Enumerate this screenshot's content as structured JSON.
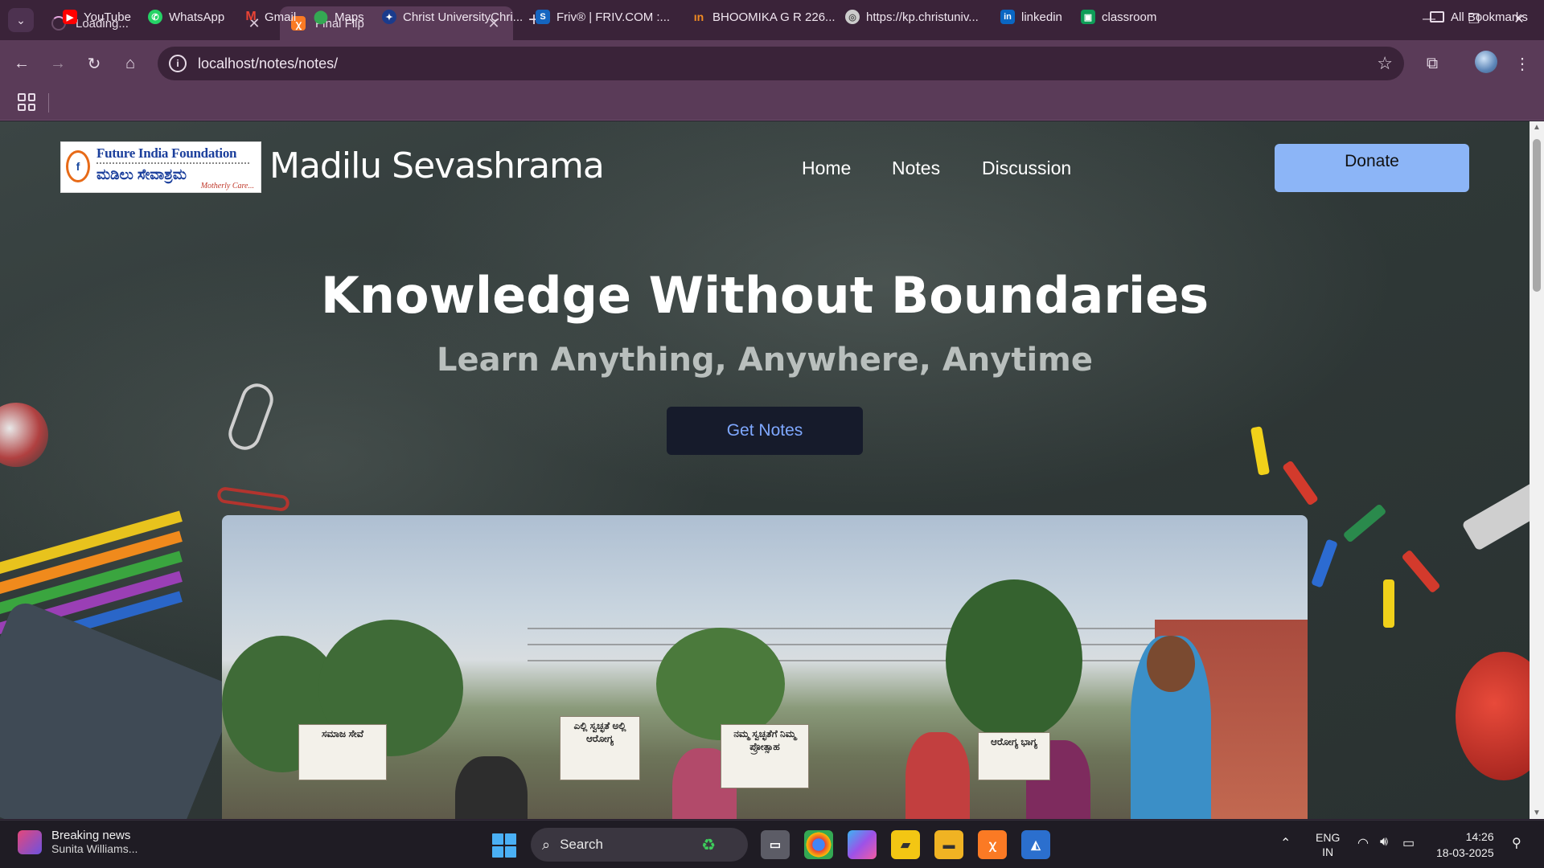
{
  "browser": {
    "tabs": [
      {
        "label": "Loading...",
        "state": "loading"
      },
      {
        "label": "Final Flip",
        "state": "active"
      }
    ],
    "new_tab_symbol": "+",
    "address": "localhost/notes/notes/",
    "window_controls": {
      "minimize": "—",
      "restore": "❐",
      "close": "✕"
    },
    "bookmarks": [
      {
        "label": "YouTube",
        "icon": "youtube-icon",
        "color": "#ff0000"
      },
      {
        "label": "WhatsApp",
        "icon": "whatsapp-icon",
        "color": "#25d366"
      },
      {
        "label": "Gmail",
        "icon": "gmail-icon",
        "color": "#ea4335"
      },
      {
        "label": "Maps",
        "icon": "maps-icon",
        "color": "#34a853"
      },
      {
        "label": "Christ UniversityChri...",
        "icon": "christ-university-icon",
        "color": "#1a3b8c"
      },
      {
        "label": "Friv® | FRIV.COM :...",
        "icon": "friv-icon",
        "color": "#1565c0"
      },
      {
        "label": "BHOOMIKA G R 226...",
        "icon": "bookmark-site-icon",
        "color": "#f28b22"
      },
      {
        "label": "https://kp.christuniv...",
        "icon": "globe-icon",
        "color": "#cccccc"
      },
      {
        "label": "linkedin",
        "icon": "linkedin-icon",
        "color": "#0a66c2"
      },
      {
        "label": "classroom",
        "icon": "classroom-icon",
        "color": "#0f9d58"
      }
    ],
    "all_bookmarks": "All Bookmarks"
  },
  "site": {
    "logo_text": "Future India Foundation",
    "logo_kannada": "ಮಡಿಲು ಸೇವಾಶ್ರಮ",
    "logo_tagline": "Motherly Care...",
    "title": "Madilu Sevashrama",
    "nav": [
      "Home",
      "Notes",
      "Discussion"
    ],
    "donate_label": "Donate",
    "accent_color": "#8cb5f7"
  },
  "hero": {
    "title": "Knowledge Without Boundaries",
    "subtitle": "Learn Anything, Anywhere, Anytime",
    "cta_label": "Get Notes"
  },
  "photo": {
    "placards": [
      "ಎಲ್ಲಿ ಸ್ವಚ್ಛತೆ ಅಲ್ಲಿ ಆರೋಗ್ಯ",
      "ನಮ್ಮ ಸ್ವಚ್ಛತೆಗೆ ನಿಮ್ಮ ಪ್ರೋತ್ಸಾಹ",
      "ಆರೋಗ್ಯ ಭಾಗ್ಯ",
      "ಸಮಾಜ ಸೇವೆ"
    ]
  },
  "taskbar": {
    "news_title": "Breaking news",
    "news_sub": "Sunita Williams...",
    "search_label": "Search",
    "lang_1": "ENG",
    "lang_2": "IN",
    "time": "14:26",
    "date": "18-03-2025"
  }
}
